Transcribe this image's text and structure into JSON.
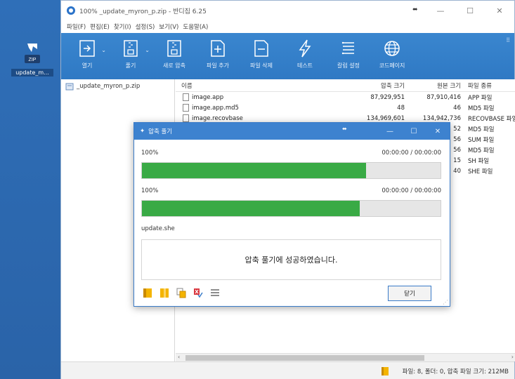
{
  "desktop": {
    "icon_label": "update_m..."
  },
  "window": {
    "title": "100% _update_myron_p.zip - 반디집 6.25",
    "controls": {
      "minimize": "—",
      "maximize": "☐",
      "close": "✕"
    }
  },
  "menu": [
    "파일(F)",
    "편집(E)",
    "찾기(I)",
    "설정(S)",
    "보기(V)",
    "도움말(A)"
  ],
  "toolbar": {
    "items": [
      {
        "label": "열기",
        "icon": "open-icon"
      },
      {
        "label": "풀기",
        "icon": "extract-icon"
      },
      {
        "label": "새로 압축",
        "icon": "new-archive-icon"
      },
      {
        "label": "파일 추가",
        "icon": "add-file-icon"
      },
      {
        "label": "파일 삭제",
        "icon": "delete-file-icon"
      },
      {
        "label": "테스트",
        "icon": "test-icon"
      },
      {
        "label": "칼럼 설정",
        "icon": "columns-icon"
      },
      {
        "label": "코드페이지",
        "icon": "globe-icon"
      }
    ]
  },
  "tree": {
    "root": "_update_myron_p.zip"
  },
  "list": {
    "headers": {
      "name": "이름",
      "compressed": "압축 크기",
      "original": "원본 크기",
      "type": "파일 종류"
    },
    "rows": [
      {
        "name": "image.app",
        "compressed": "87,929,951",
        "original": "87,910,416",
        "type": "APP 파일"
      },
      {
        "name": "image.app.md5",
        "compressed": "48",
        "original": "46",
        "type": "MD5 파일"
      },
      {
        "name": "image.recovbase",
        "compressed": "134,969,601",
        "original": "134,942,736",
        "type": "RECOVBASE 파일"
      },
      {
        "name": "",
        "compressed": "",
        "original": "52",
        "type": "MD5 파일"
      },
      {
        "name": "",
        "compressed": "",
        "original": "56",
        "type": "SUM 파일"
      },
      {
        "name": "",
        "compressed": "",
        "original": "56",
        "type": "MD5 파일"
      },
      {
        "name": "",
        "compressed": "",
        "original": "15",
        "type": "SH 파일"
      },
      {
        "name": "",
        "compressed": "",
        "original": "40",
        "type": "SHE 파일"
      }
    ]
  },
  "status": {
    "text": "파일: 8, 폴더: 0, 압축 파일 크기: 212MB"
  },
  "dialog": {
    "title": "압축 풀기",
    "progress1": {
      "percent": "100%",
      "time": "00:00:00 / 00:00:00",
      "fill": 0.75
    },
    "progress2": {
      "percent": "100%",
      "time": "00:00:00 / 00:00:00",
      "fill": 0.73
    },
    "current_file": "update.she",
    "message": "압축 풀기에 성공하였습니다.",
    "close_label": "닫기"
  },
  "colors": {
    "accent": "#3a86cf",
    "progress": "#39aa45",
    "dialog_title": "#3d82cf"
  }
}
